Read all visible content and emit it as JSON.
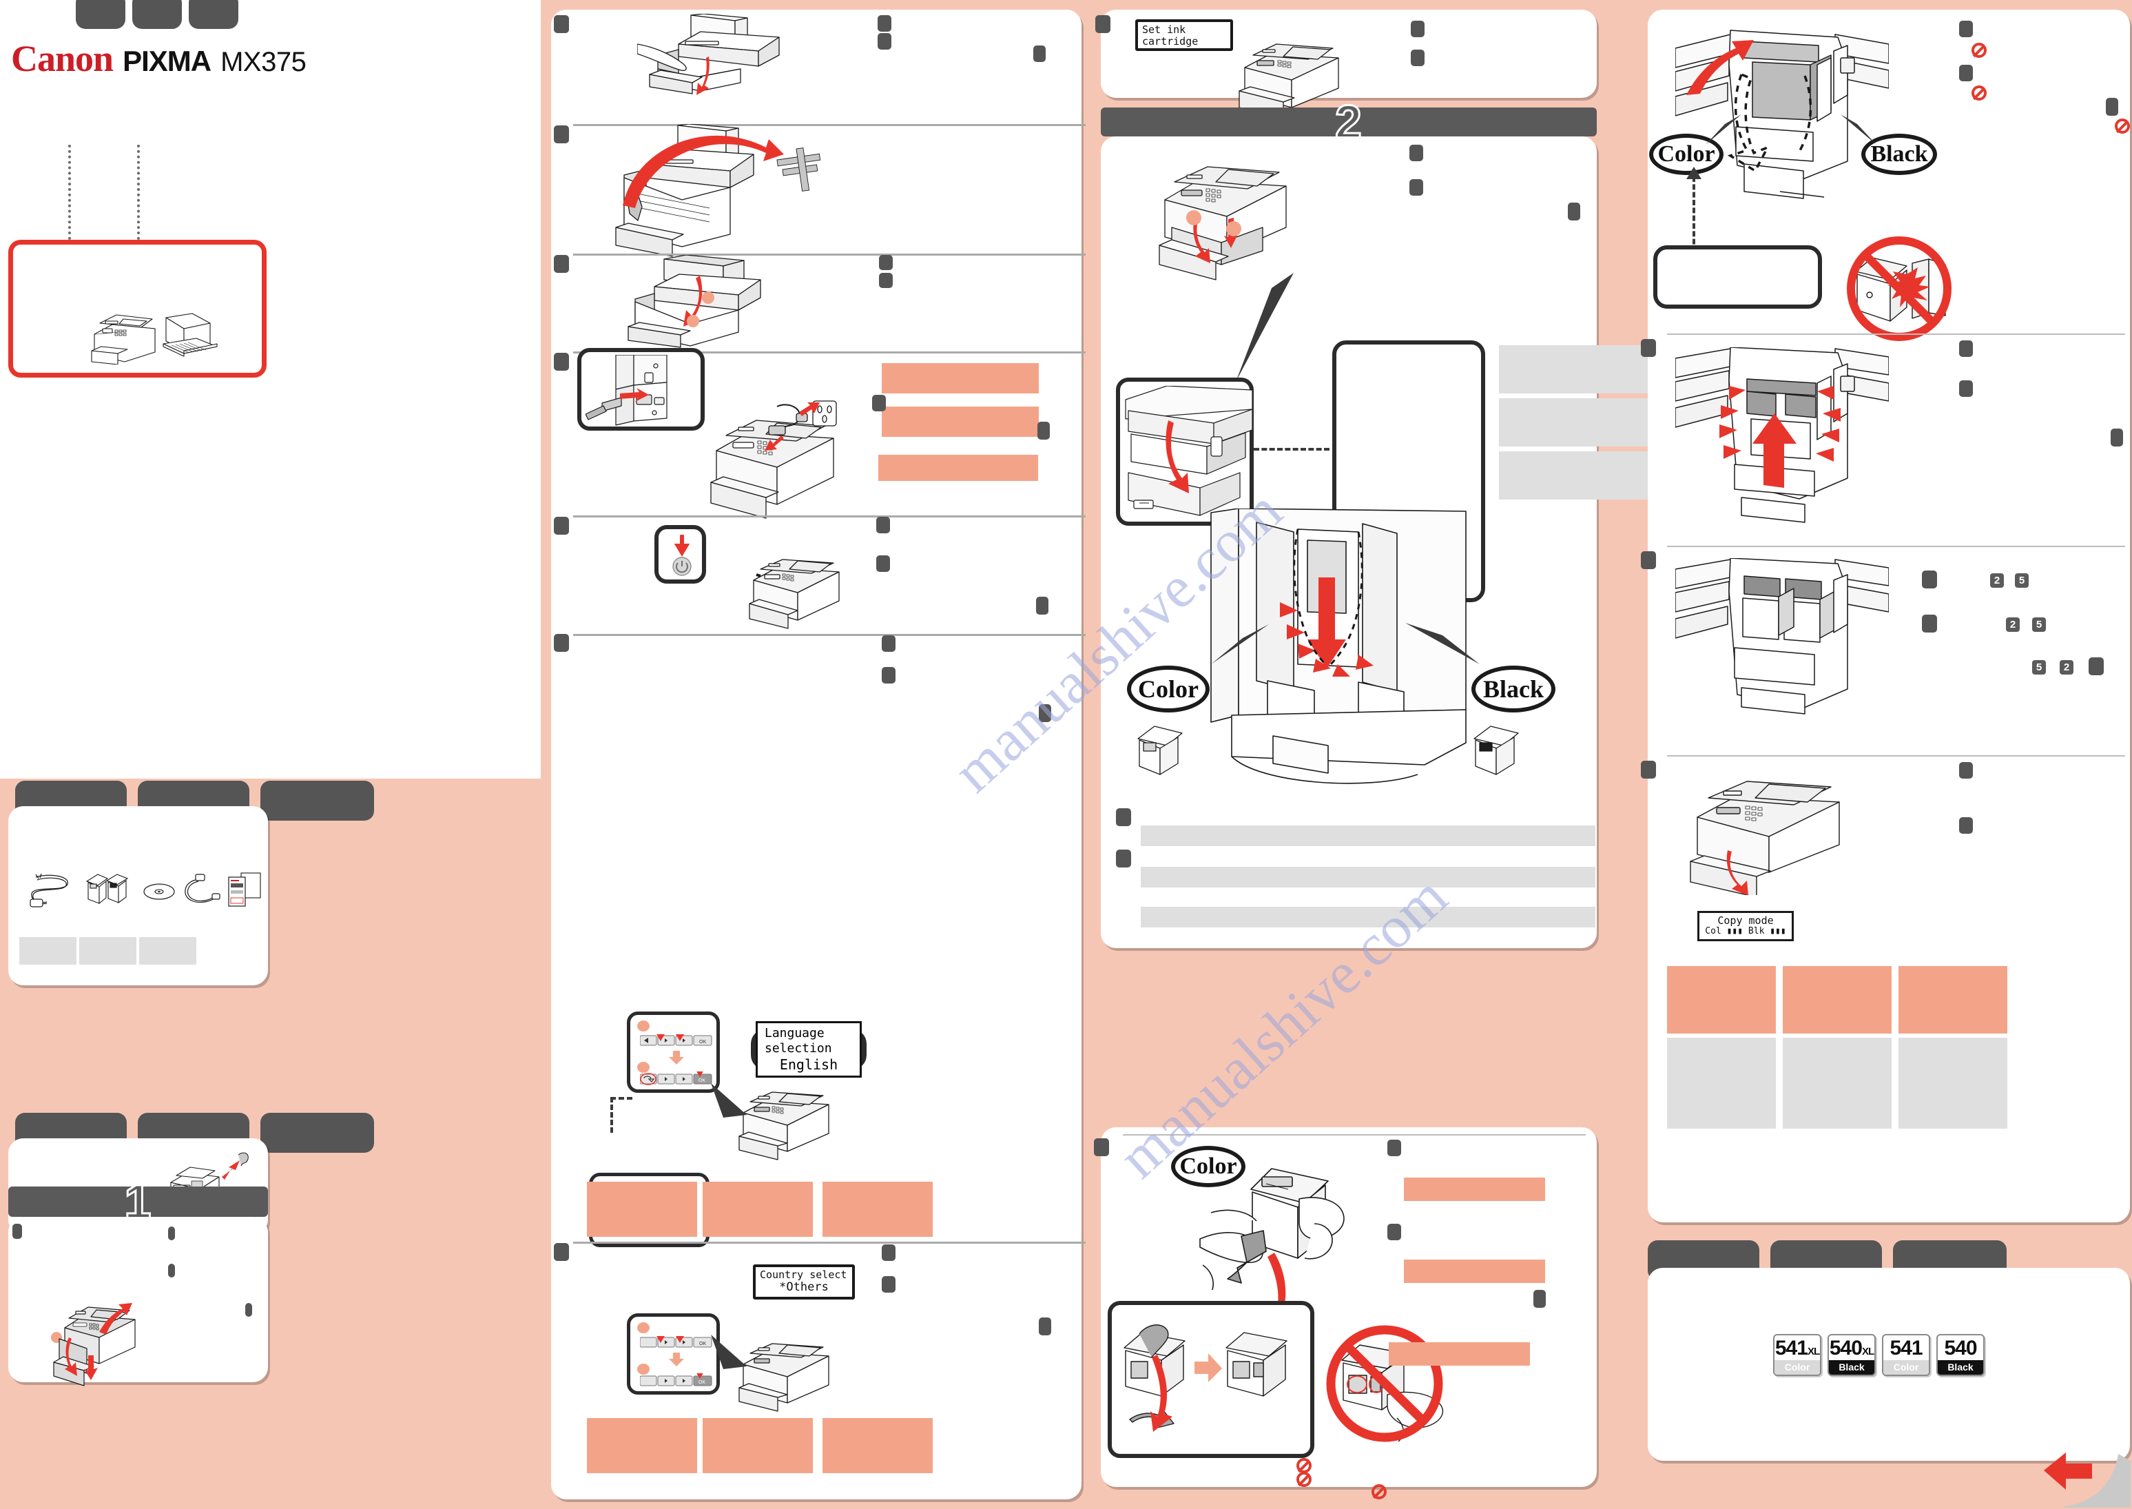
{
  "document": {
    "brand_canon": "Canon",
    "brand_pixma": "PIXMA",
    "model": "MX375",
    "watermark": "manualshive.com"
  },
  "steps": {
    "step1_number": "1",
    "step2_number": "2"
  },
  "lcd_screens": {
    "set_ink_cartridge": {
      "line1": "Set ink cartridge",
      "line2": ""
    },
    "language_selection": {
      "line1": "Language selection",
      "line2": "English"
    },
    "country_select": {
      "line1": "Country select",
      "line2": "*Others"
    },
    "copy_mode": {
      "line1": "Copy mode",
      "line2": "Col ▮▮▮  Blk ▮▮▮"
    }
  },
  "callouts": {
    "color": "Color",
    "black": "Black"
  },
  "ink_cartridges": [
    {
      "number": "541",
      "suffix": "XL",
      "type": "Color"
    },
    {
      "number": "540",
      "suffix": "XL",
      "type": "Black"
    },
    {
      "number": "541",
      "suffix": "",
      "type": "Color"
    },
    {
      "number": "540",
      "suffix": "",
      "type": "Black"
    }
  ],
  "reference_badges": [
    "2",
    "5",
    "2",
    "5",
    "5",
    "2"
  ],
  "colors": {
    "background_peach": "#f6c6b4",
    "accent_red": "#e8352b",
    "brand_red": "#cc1e26",
    "tab_gray": "#555555",
    "placeholder_gray": "#dfdfdf",
    "placeholder_peach": "#f3a488",
    "step_banner": "#5a5a5a"
  }
}
